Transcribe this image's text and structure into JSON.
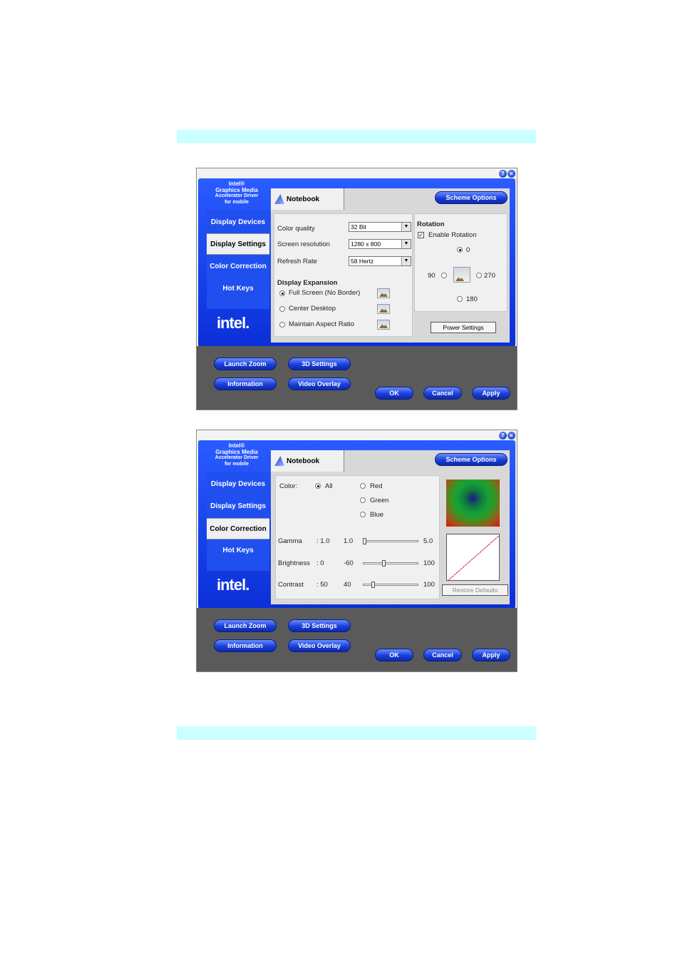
{
  "page": {
    "colors": {
      "band": "#ccffff",
      "frame": "#1a47f0",
      "bottom": "#5a5a5a"
    }
  },
  "win1": {
    "brand": {
      "l1": "Intel®",
      "l2": "Graphics Media",
      "l3": "Accelerator Driver",
      "l4": "for mobile"
    },
    "nav": [
      "Display Devices",
      "Display Settings",
      "Color Correction",
      "Hot Keys"
    ],
    "logo": "intel.",
    "tab": "Notebook",
    "scheme": "Scheme Options",
    "color_quality": {
      "label": "Color quality",
      "value": "32 Bit"
    },
    "resolution": {
      "label": "Screen resolution",
      "value": "1280 x 800"
    },
    "refresh": {
      "label": "Refresh Rate",
      "value": "58 Hertz"
    },
    "expansion": {
      "title": "Display Expansion",
      "o1": "Full Screen (No Border)",
      "o2": "Center Desktop",
      "o3": "Maintain Aspect Ratio"
    },
    "rotation": {
      "title": "Rotation",
      "enable": "Enable Rotation",
      "r0": "0",
      "r90": "90",
      "r270": "270",
      "r180": "180"
    },
    "power": "Power Settings",
    "bottom": {
      "zoom": "Launch Zoom",
      "s3d": "3D Settings",
      "info": "Information",
      "video": "Video Overlay",
      "ok": "OK",
      "cancel": "Cancel",
      "apply": "Apply"
    }
  },
  "win2": {
    "brand": {
      "l1": "Intel®",
      "l2": "Graphics Media",
      "l3": "Accelerator Driver",
      "l4": "for mobile"
    },
    "nav": [
      "Display Devices",
      "Display Settings",
      "Color Correction",
      "Hot Keys"
    ],
    "logo": "intel.",
    "tab": "Notebook",
    "scheme": "Scheme Options",
    "color": {
      "label": "Color:",
      "all": "All",
      "red": "Red",
      "green": "Green",
      "blue": "Blue"
    },
    "gamma": {
      "label": "Gamma",
      "value": ": 1.0",
      "min": "1.0",
      "max": "5.0",
      "level": 0.0
    },
    "brightness": {
      "label": "Brightness",
      "value": ": 0",
      "min": "-60",
      "max": "100",
      "level": 0.375
    },
    "contrast": {
      "label": "Contrast",
      "value": ": 50",
      "min": "40",
      "max": "100",
      "level": 0.167
    },
    "restore": "Restore Defaults",
    "bottom": {
      "zoom": "Launch Zoom",
      "s3d": "3D Settings",
      "info": "Information",
      "video": "Video Overlay",
      "ok": "OK",
      "cancel": "Cancel",
      "apply": "Apply"
    }
  }
}
